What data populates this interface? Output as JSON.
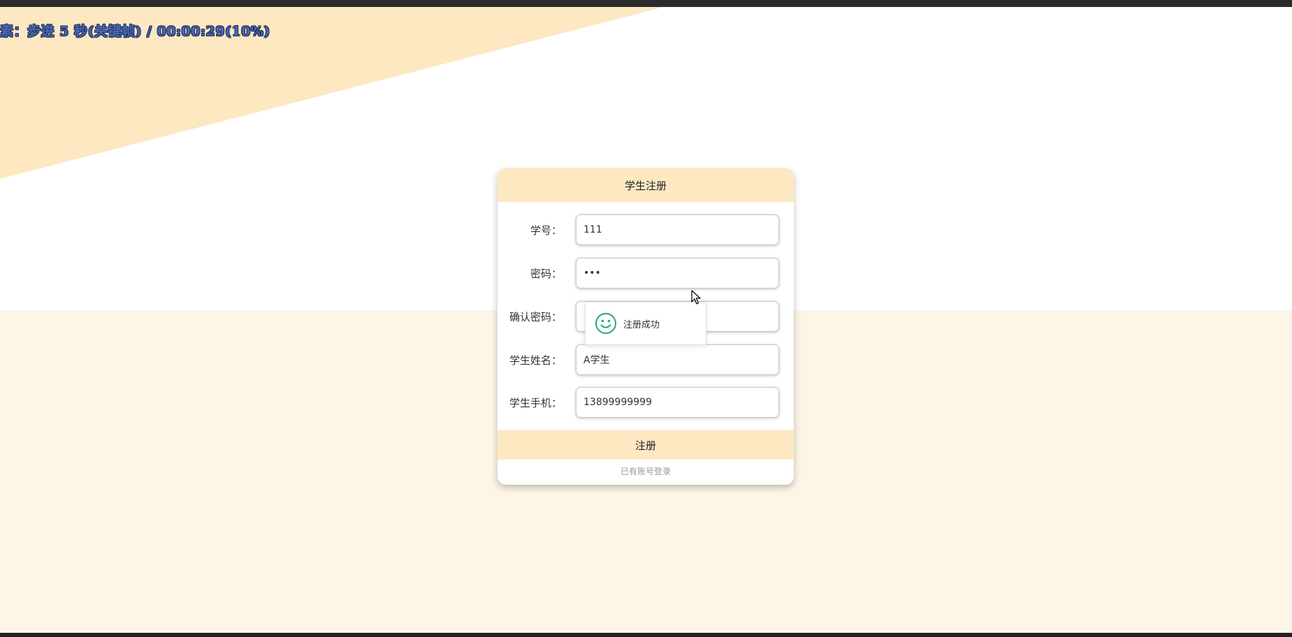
{
  "overlay": {
    "caption": "素：步进 5 秒(关键帧) / 00:00:29(10%)"
  },
  "form": {
    "title": "学生注册",
    "fields": [
      {
        "label": "学号：",
        "value": "111",
        "type": "text"
      },
      {
        "label": "密码：",
        "value": "111",
        "type": "password"
      },
      {
        "label": "确认密码：",
        "value": "111",
        "type": "password"
      },
      {
        "label": "学生姓名：",
        "value": "A学生",
        "type": "text"
      },
      {
        "label": "学生手机：",
        "value": "13899999999",
        "type": "text"
      }
    ],
    "submit_label": "注册",
    "login_link": "已有账号登录"
  },
  "toast": {
    "message": "注册成功",
    "icon": "smile-icon"
  },
  "colors": {
    "accent": "#fde8c2",
    "background": "#fdf6e6",
    "toast_icon": "#2aa57a",
    "overlay_text": "#4a69b5"
  }
}
